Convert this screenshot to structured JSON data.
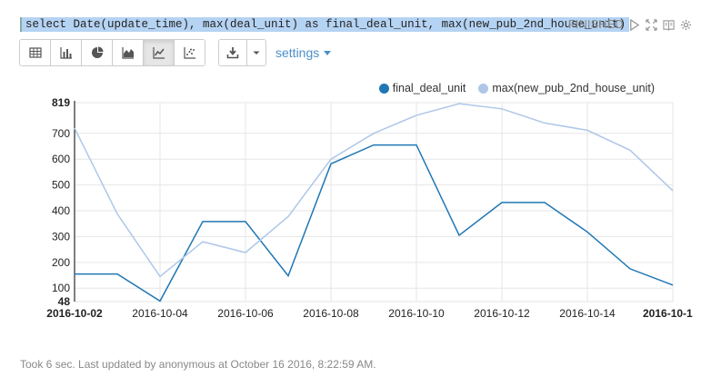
{
  "query": "select Date(update_time), max(deal_unit) as final_deal_unit, max(new_pub_2nd_house_unit)",
  "status": "FINISHED",
  "toolbar": {
    "settings_label": "settings"
  },
  "footer": {
    "text": "Took 6 sec. Last updated by anonymous at October 16 2016, 8:22:59 AM."
  },
  "colors": {
    "series1": "#1f77b4",
    "series2": "#aec7e8",
    "grid": "#e6e6e6",
    "query_highlight": "#b5d3f3",
    "accent": "#4a90c8"
  },
  "chart_data": {
    "type": "line",
    "x": [
      "2016-10-02",
      "2016-10-03",
      "2016-10-04",
      "2016-10-05",
      "2016-10-06",
      "2016-10-07",
      "2016-10-08",
      "2016-10-09",
      "2016-10-10",
      "2016-10-11",
      "2016-10-12",
      "2016-10-13",
      "2016-10-14",
      "2016-10-15",
      "2016-10-16"
    ],
    "x_tick_labels": [
      "2016-10-02",
      "2016-10-04",
      "2016-10-06",
      "2016-10-08",
      "2016-10-10",
      "2016-10-12",
      "2016-10-14",
      "2016-10-1"
    ],
    "y_tick_labels": [
      "48",
      "100",
      "200",
      "300",
      "400",
      "500",
      "600",
      "700",
      "819"
    ],
    "y_ticks": [
      48,
      100,
      200,
      300,
      400,
      500,
      600,
      700,
      819
    ],
    "ylim": [
      48,
      819
    ],
    "grid": true,
    "legend_position": "top-right",
    "series": [
      {
        "name": "final_deal_unit",
        "values": [
          155,
          155,
          50,
          358,
          358,
          148,
          582,
          655,
          655,
          305,
          432,
          432,
          318,
          175,
          112
        ]
      },
      {
        "name": "max(new_pub_2nd_house_unit)",
        "values": [
          720,
          388,
          145,
          280,
          238,
          378,
          600,
          700,
          770,
          815,
          795,
          740,
          712,
          635,
          478
        ]
      }
    ]
  }
}
